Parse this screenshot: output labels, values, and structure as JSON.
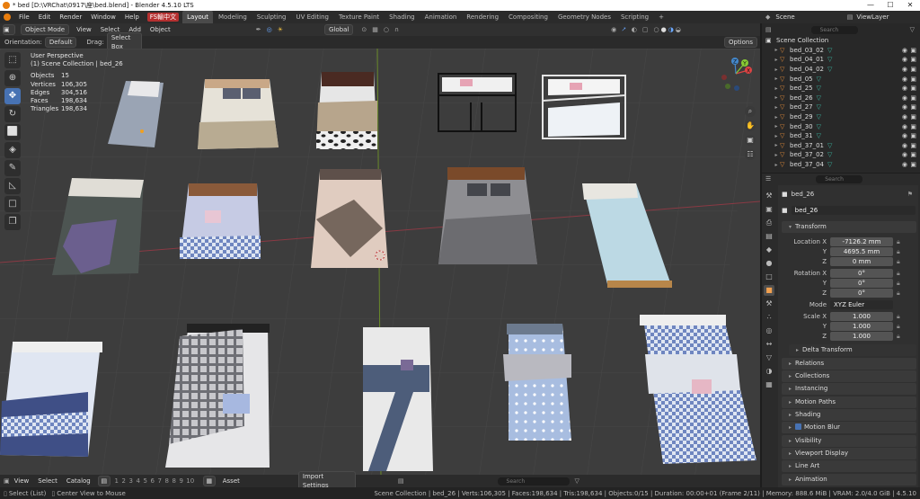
{
  "titlebar": {
    "title": "* bed [D:\\VRChat\\0917\\座\\bed.blend] - Blender 4.5.10 LTS",
    "min": "—",
    "max": "☐",
    "close": "✕"
  },
  "menu": {
    "file": "File",
    "edit": "Edit",
    "render": "Render",
    "window": "Window",
    "help": "Help",
    "ime": "FS輸中文"
  },
  "workspaces": [
    "Layout",
    "Modeling",
    "Sculpting",
    "UV Editing",
    "Texture Paint",
    "Shading",
    "Animation",
    "Rendering",
    "Compositing",
    "Geometry Nodes",
    "Scripting"
  ],
  "workspace_add": "+",
  "scene": {
    "label": "Scene",
    "viewlayer": "ViewLayer"
  },
  "vphead": {
    "mode": "Object Mode",
    "view": "View",
    "select": "Select",
    "add": "Add",
    "object": "Object",
    "transform": "Global"
  },
  "toolhead": {
    "orientation_label": "Orientation:",
    "orientation": "Default",
    "drag_label": "Drag:",
    "drag": "Select Box",
    "options": "Options"
  },
  "overlay_text": {
    "perspective": "User Perspective",
    "collection": "(1) Scene Collection | bed_26"
  },
  "stats": [
    [
      "Objects",
      "15"
    ],
    [
      "Vertices",
      "106,305"
    ],
    [
      "Edges",
      "304,516"
    ],
    [
      "Faces",
      "198,634"
    ],
    [
      "Triangles",
      "198,634"
    ]
  ],
  "outliner": {
    "search": "Search",
    "root": "Scene Collection",
    "items": [
      "bed_03_02",
      "bed_04_01",
      "bed_04_02",
      "bed_05",
      "bed_25",
      "bed_26",
      "bed_27",
      "bed_29",
      "bed_30",
      "bed_31",
      "bed_37_01",
      "bed_37_02",
      "bed_37_04"
    ]
  },
  "props": {
    "search": "Search",
    "object": "bed_26",
    "name": "bed_26",
    "transform": "Transform",
    "location": {
      "label": "Location X",
      "x": "-7126.2 mm",
      "y": "4695.5 mm",
      "z": "0 mm"
    },
    "rotation": {
      "label": "Rotation X",
      "x": "0°",
      "y": "0°",
      "z": "0°"
    },
    "mode": {
      "label": "Mode",
      "value": "XYZ Euler"
    },
    "scale": {
      "label": "Scale X",
      "x": "1.000",
      "y": "1.000",
      "z": "1.000"
    },
    "y": "Y",
    "z": "Z",
    "delta": "Delta Transform",
    "panels": [
      "Relations",
      "Collections",
      "Instancing",
      "Motion Paths",
      "Shading",
      "Motion Blur",
      "Visibility",
      "Viewport Display",
      "Line Art",
      "Animation"
    ]
  },
  "footer": {
    "view": "View",
    "select": "Select",
    "catalog": "Catalog",
    "asset": "Asset",
    "import": "Import Settings",
    "search": "Search",
    "pages": [
      "1",
      "2",
      "3",
      "4",
      "5",
      "6",
      "7",
      "8",
      "8",
      "9",
      "10"
    ]
  },
  "statusbar": {
    "select": "Select (List)",
    "center": "Center View to Mouse",
    "info": "Scene Collection | bed_26 | Verts:106,305 | Faces:198,634 | Tris:198,634 | Objects:0/15 | Duration: 00:00+01 (Frame 2/11) | Memory: 888.6 MiB | VRAM: 2.0/4.0 GiB | 4.5.10"
  },
  "gizmo": {
    "x": "X",
    "y": "Y",
    "z": "Z"
  },
  "colors": {
    "accent": "#4772b3",
    "active_tab": "#4a4a4a",
    "bg_viewport": "#3d3d3d"
  }
}
